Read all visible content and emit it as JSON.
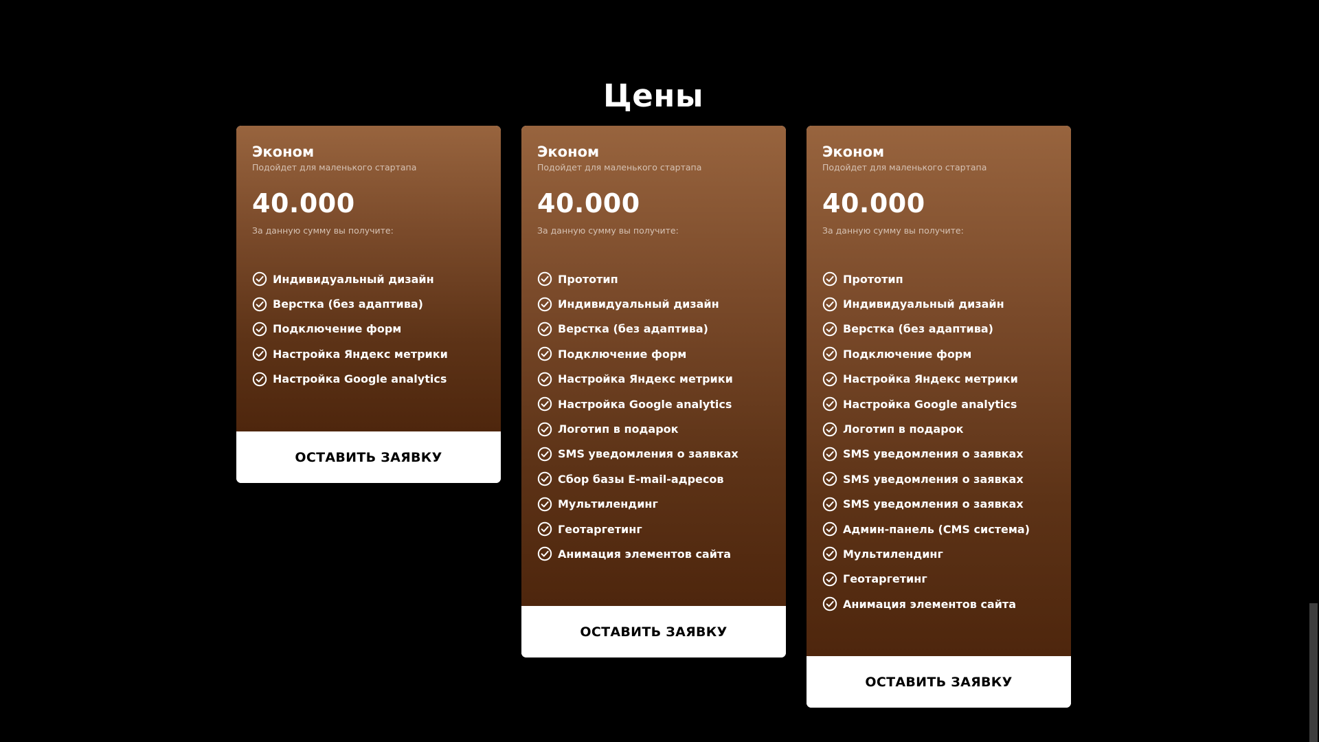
{
  "section": {
    "title": "Цены"
  },
  "plans": [
    {
      "name": "Эконом",
      "subtitle": "Подойдет для маленького стартапа",
      "price": "40.000",
      "price_note": "За данную сумму вы получите:",
      "features": [
        "Индивидуальный дизайн",
        "Верстка (без адаптива)",
        "Подключение форм",
        "Настройка Яндекс метрики",
        "Настройка Google analytics"
      ],
      "cta": "ОСТАВИТЬ ЗАЯВКУ"
    },
    {
      "name": "Эконом",
      "subtitle": "Подойдет для маленького стартапа",
      "price": "40.000",
      "price_note": "За данную сумму вы получите:",
      "features": [
        "Прототип",
        "Индивидуальный дизайн",
        "Верстка (без адаптива)",
        "Подключение форм",
        "Настройка Яндекс метрики",
        "Настройка Google analytics",
        "Логотип в подарок",
        "SMS уведомления о заявках",
        "Сбор базы E-mail-адресов",
        "Мультилендинг",
        "Геотаргетинг",
        "Анимация элементов сайта"
      ],
      "cta": "ОСТАВИТЬ ЗАЯВКУ"
    },
    {
      "name": "Эконом",
      "subtitle": "Подойдет для маленького стартапа",
      "price": "40.000",
      "price_note": "За данную сумму вы получите:",
      "features": [
        "Прототип",
        "Индивидуальный дизайн",
        "Верстка (без адаптива)",
        "Подключение форм",
        "Настройка Яндекс метрики",
        "Настройка Google analytics",
        "Логотип в подарок",
        "SMS уведомления о заявках",
        "SMS уведомления о заявках",
        "SMS уведомления о заявках",
        "Админ-панель (CMS система)",
        "Мультилендинг",
        "Геотаргетинг",
        "Анимация элементов сайта"
      ],
      "cta": "ОСТАВИТЬ ЗАЯВКУ"
    }
  ],
  "icons": {
    "feature": "check-circle-icon"
  },
  "colors": {
    "background": "#000000",
    "card_top": "#98643e",
    "card_bottom": "#4e260d",
    "button_bg": "#ffffff",
    "button_text": "#000000"
  }
}
